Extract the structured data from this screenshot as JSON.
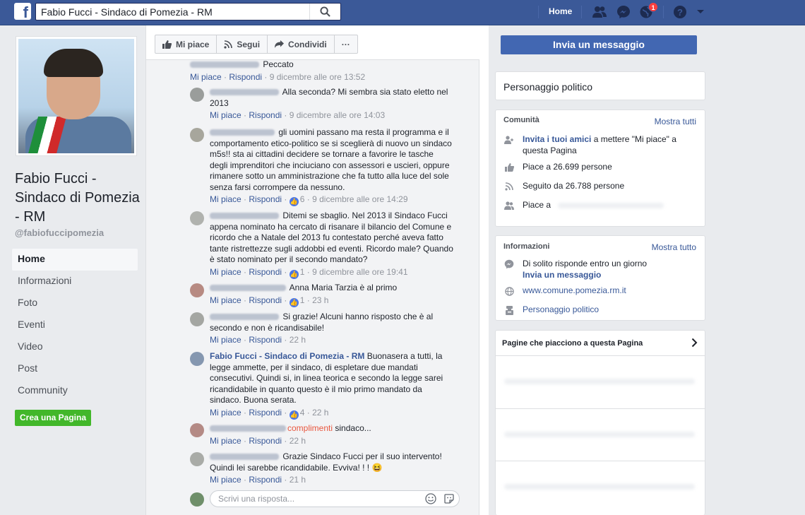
{
  "topbar": {
    "search_value": "Fabio Fucci - Sindaco di Pomezia - RM",
    "home_label": "Home",
    "notification_count": "1",
    "brand_color": "#3b5998"
  },
  "left": {
    "page_name": "Fabio Fucci - Sindaco di Pomezia - RM",
    "handle": "@fabiofuccipomezia",
    "nav": [
      {
        "label": "Home",
        "active": true
      },
      {
        "label": "Informazioni"
      },
      {
        "label": "Foto"
      },
      {
        "label": "Eventi"
      },
      {
        "label": "Video"
      },
      {
        "label": "Post"
      },
      {
        "label": "Community"
      }
    ],
    "create_page_label": "Crea una Pagina"
  },
  "actionbar": {
    "like_label": "Mi piace",
    "follow_label": "Segui",
    "share_label": "Condividi",
    "more_label": "···"
  },
  "comments": [
    {
      "text": "Peccato",
      "like": "Mi piace",
      "reply": "Rispondi",
      "reactions": "",
      "time": "9 dicembre alle ore 13:52"
    },
    {
      "text": "Alla seconda? Mi sembra sia stato eletto nel 2013",
      "like": "Mi piace",
      "reply": "Rispondi",
      "reactions": "",
      "time": "9 dicembre alle ore 14:03"
    },
    {
      "text": "gli uomini passano ma resta il programma e il comportamento etico-politico se si sceglierà di nuovo un sindaco m5s!! sta ai cittadini decidere se tornare a favorire le tasche degli imprenditori che inciuciano con assessori e uscieri, oppure rimanere sotto un amministrazione che fa tutto alla luce del sole senza farsi corrompere da nessuno.",
      "like": "Mi piace",
      "reply": "Rispondi",
      "reactions": "6",
      "time": "9 dicembre alle ore 14:29"
    },
    {
      "text": "Ditemi se sbaglio. Nel 2013 il Sindaco Fucci appena nominato ha cercato di risanare il bilancio del Comune e ricordo che a Natale del 2013 fu contestato perché aveva fatto tante ristrettezze sugli addobbi ed eventi. Ricordo male? Quando è stato nominato per il secondo mandato?",
      "like": "Mi piace",
      "reply": "Rispondi",
      "reactions": "1",
      "time": "9 dicembre alle ore 19:41"
    },
    {
      "text": "Anna Maria Tarzia è al primo",
      "like": "Mi piace",
      "reply": "Rispondi",
      "reactions": "1",
      "time": "23 h"
    },
    {
      "text": "Si grazie! Alcuni hanno risposto che è al secondo e non è ricandisabile!",
      "like": "Mi piace",
      "reply": "Rispondi",
      "reactions": "",
      "time": "22 h"
    },
    {
      "author": "Fabio Fucci - Sindaco di Pomezia - RM",
      "text": "Buonasera a tutti, la legge ammette, per il sindaco, di espletare due mandati consecutivi. Quindi si, in linea teorica e secondo la legge sarei ricandidabile in quanto questo è il mio primo mandato da sindaco. Buona serata.",
      "like": "Mi piace",
      "reply": "Rispondi",
      "reactions": "4",
      "time": "22 h"
    },
    {
      "highlight": "complimenti",
      "text": "sindaco...",
      "like": "Mi piace",
      "reply": "Rispondi",
      "reactions": "",
      "time": "22 h"
    },
    {
      "text": "Grazie Sindaco Fucci per il suo intervento! Quindi lei sarebbe ricandidabile. Evviva! ! ! 😆",
      "like": "Mi piace",
      "reply": "Rispondi",
      "reactions": "",
      "time": "21 h"
    }
  ],
  "reply_placeholder": "Scrivi una risposta...",
  "right": {
    "message_button": "Invia un messaggio",
    "category": "Personaggio politico",
    "community": {
      "heading": "Comunità",
      "show_all": "Mostra tutti",
      "invite_link": "Invita i tuoi amici",
      "invite_rest": " a mettere \"Mi piace\" a questa Pagina",
      "likes": "Piace a 26.699 persone",
      "follows": "Seguito da 26.788 persone",
      "friends_like": "Piace a"
    },
    "info": {
      "heading": "Informazioni",
      "show_all": "Mostra tutto",
      "response": "Di solito risponde entro un giorno",
      "send_message": "Invia un messaggio",
      "website": "www.comune.pomezia.rm.it",
      "category": "Personaggio politico"
    },
    "liked_pages": {
      "heading": "Pagine che piacciono a questa Pagina"
    }
  }
}
